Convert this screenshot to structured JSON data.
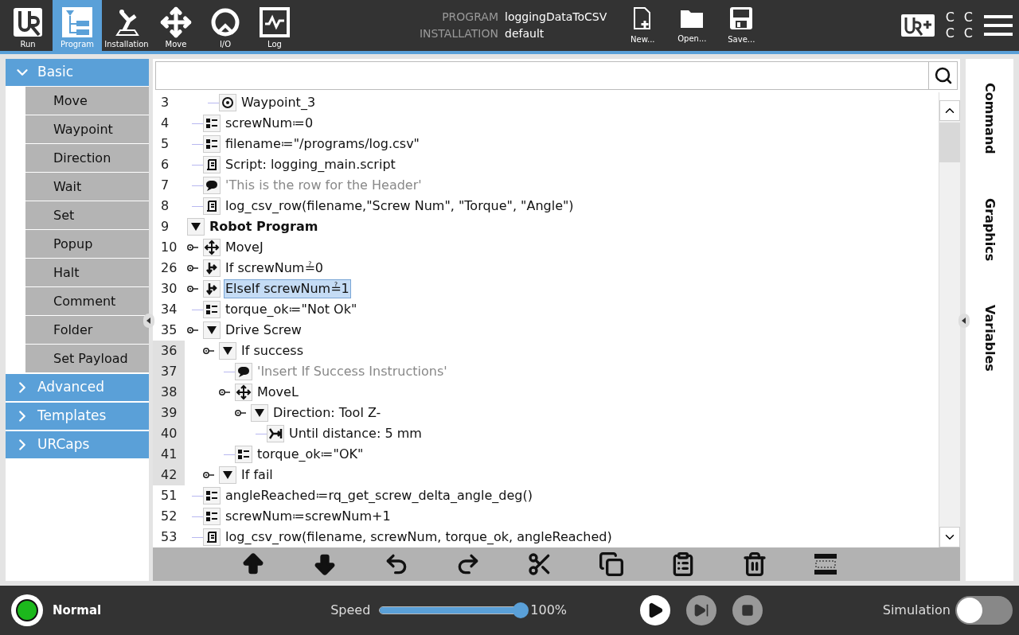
{
  "header": {
    "tabs": [
      {
        "label": "Run",
        "kind": "run",
        "selected": false
      },
      {
        "label": "Program",
        "kind": "program",
        "selected": true
      },
      {
        "label": "Installation",
        "kind": "installation",
        "selected": false
      },
      {
        "label": "Move",
        "kind": "move",
        "selected": false
      },
      {
        "label": "I/O",
        "kind": "io",
        "selected": false
      },
      {
        "label": "Log",
        "kind": "log",
        "selected": false
      }
    ],
    "program_label": "PROGRAM",
    "program_name": "loggingDataToCSV",
    "installation_label": "INSTALLATION",
    "installation_name": "default",
    "file_buttons": [
      {
        "label": "New...",
        "kind": "new"
      },
      {
        "label": "Open...",
        "kind": "open"
      },
      {
        "label": "Save...",
        "kind": "save"
      }
    ],
    "status_letters": [
      "C",
      "C",
      "C",
      "C"
    ]
  },
  "sidebar": {
    "categories": [
      {
        "label": "Basic",
        "expanded": true,
        "items": [
          "Move",
          "Waypoint",
          "Direction",
          "Wait",
          "Set",
          "Popup",
          "Halt",
          "Comment",
          "Folder",
          "Set Payload"
        ]
      },
      {
        "label": "Advanced",
        "expanded": false
      },
      {
        "label": "Templates",
        "expanded": false
      },
      {
        "label": "URCaps",
        "expanded": false
      }
    ]
  },
  "program_tree": {
    "items": [
      {
        "kind": "offscreen",
        "children": [
          {
            "kind": "offscreen",
            "children": [
              {
                "line": "3",
                "kind": "waypoint",
                "text": "Waypoint_3"
              }
            ]
          },
          {
            "line": "4",
            "kind": "assign",
            "text": "screwNum≔0"
          },
          {
            "line": "5",
            "kind": "assign",
            "text": "filename≔\"/programs/log.csv\""
          },
          {
            "line": "6",
            "kind": "script",
            "text": "Script: logging_main.script"
          },
          {
            "line": "7",
            "kind": "comment",
            "text": "'This is the row for the Header'"
          },
          {
            "line": "8",
            "kind": "script",
            "text": "log_csv_row(filename,\"Screw Num\", \"Torque\", \"Angle\")"
          }
        ]
      },
      {
        "line": "9",
        "kind": "root",
        "text": "Robot Program",
        "expanded": true,
        "children": [
          {
            "line": "10",
            "kind": "move",
            "text": "MoveJ",
            "node": true
          },
          {
            "line": "26",
            "kind": "if",
            "text": "If screwNum≟0",
            "node": true
          },
          {
            "line": "30",
            "kind": "if",
            "text": "ElseIf screwNum≟1",
            "node": true,
            "selected": true
          },
          {
            "line": "34",
            "kind": "assign",
            "text": "torque_ok≔\"Not Ok\""
          },
          {
            "line": "35",
            "kind": "group",
            "text": "Drive Screw",
            "node": true,
            "expanded": true,
            "children": [
              {
                "line": "36",
                "kind": "group",
                "text": "If success",
                "node": true,
                "expanded": true,
                "marked": true,
                "children": [
                  {
                    "line": "37",
                    "kind": "comment",
                    "text": "'Insert If Success Instructions'",
                    "marked": true
                  },
                  {
                    "line": "38",
                    "kind": "move",
                    "text": "MoveL",
                    "node": true,
                    "marked": true,
                    "children": [
                      {
                        "line": "39",
                        "kind": "group",
                        "text": "Direction: Tool Z-",
                        "node": true,
                        "expanded": true,
                        "marked": true,
                        "children": [
                          {
                            "line": "40",
                            "kind": "until",
                            "text": "Until distance: 5 mm",
                            "marked": true
                          }
                        ]
                      }
                    ]
                  },
                  {
                    "line": "41",
                    "kind": "assign",
                    "text": "torque_ok≔\"OK\"",
                    "marked": true
                  }
                ]
              },
              {
                "line": "42",
                "kind": "group",
                "text": "If fail",
                "node": true,
                "expanded": true,
                "marked": true
              }
            ]
          },
          {
            "line": "51",
            "kind": "assign",
            "text": "angleReached≔rq_get_screw_delta_angle_deg()"
          },
          {
            "line": "52",
            "kind": "assign",
            "text": "screwNum≔screwNum+1"
          },
          {
            "line": "53",
            "kind": "script",
            "text": "log_csv_row(filename, screwNum, torque_ok, angleReached)"
          }
        ]
      }
    ]
  },
  "right_tabs": [
    "Command",
    "Graphics",
    "Variables"
  ],
  "footer": {
    "status": "Normal",
    "speed_label": "Speed",
    "speed": {
      "level": 1.0
    },
    "speed_reading": "100%",
    "simulation_label": "Simulation",
    "simulation": {
      "on": false
    }
  }
}
